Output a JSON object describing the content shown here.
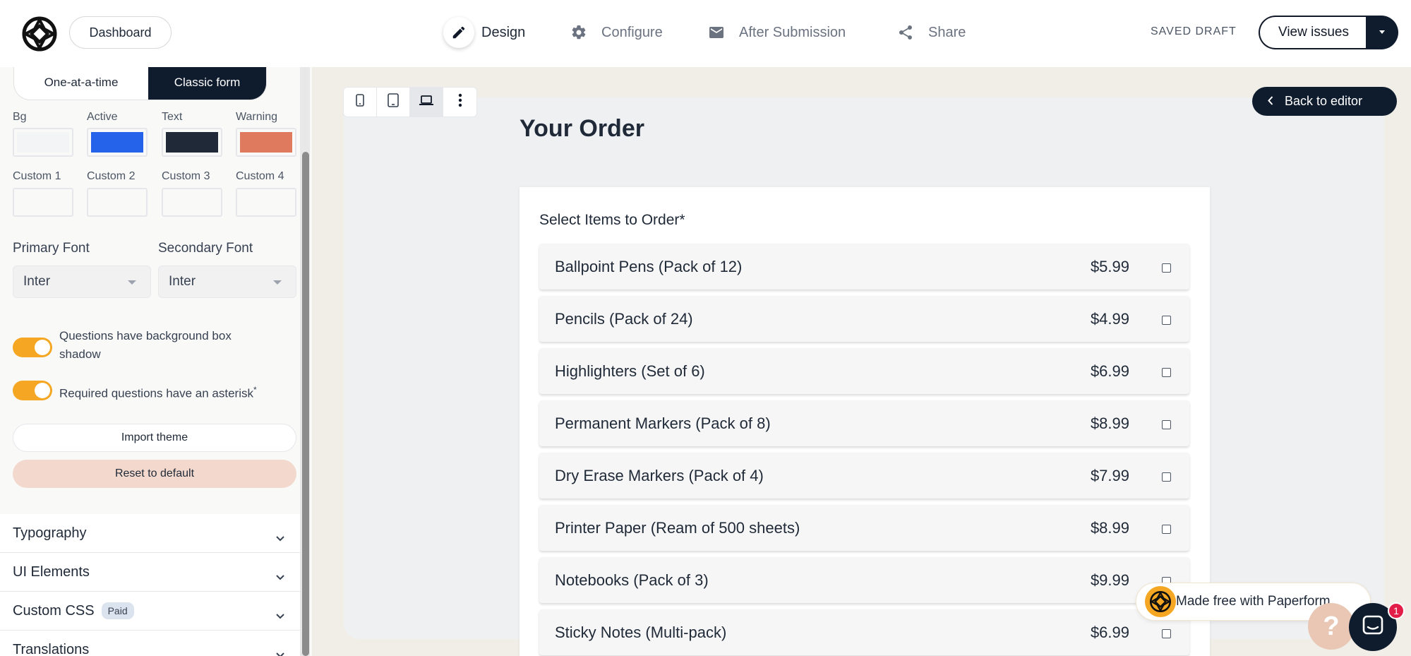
{
  "header": {
    "dashboard_label": "Dashboard",
    "nav": [
      {
        "label": "Design",
        "icon": "pencil-icon"
      },
      {
        "label": "Configure",
        "icon": "gear-icon"
      },
      {
        "label": "After Submission",
        "icon": "envelope-icon"
      },
      {
        "label": "Share",
        "icon": "share-icon"
      }
    ],
    "saved_status": "SAVED DRAFT",
    "view_issues_label": "View issues"
  },
  "sidebar": {
    "layout_options": [
      "One-at-a-time",
      "Classic form"
    ],
    "selected_layout": "Classic form",
    "colors": [
      {
        "label": "Bg",
        "value": "#f3f4f6"
      },
      {
        "label": "Active",
        "value": "#2563eb"
      },
      {
        "label": "Text",
        "value": "#1f2937"
      },
      {
        "label": "Warning",
        "value": "#e07a5f"
      },
      {
        "label": "Custom 1",
        "value": "#ffffff"
      },
      {
        "label": "Custom 2",
        "value": "#ffffff"
      },
      {
        "label": "Custom 3",
        "value": "#ffffff"
      },
      {
        "label": "Custom 4",
        "value": "#ffffff"
      }
    ],
    "primary_font_label": "Primary Font",
    "primary_font_value": "Inter",
    "secondary_font_label": "Secondary Font",
    "secondary_font_value": "Inter",
    "toggles": [
      {
        "label": "Questions have background box shadow",
        "on": true
      },
      {
        "label": "Required questions have an asterisk",
        "on": true
      }
    ],
    "asterisk": "*",
    "import_theme_label": "Import theme",
    "reset_label": "Reset to default",
    "accordions": [
      {
        "label": "Typography"
      },
      {
        "label": "UI Elements"
      },
      {
        "label": "Custom CSS",
        "badge": "Paid"
      },
      {
        "label": "Translations"
      }
    ]
  },
  "preview": {
    "back_label": "Back to editor",
    "form_title": "Your Order",
    "question_label": "Select Items to Order*",
    "items": [
      {
        "name": "Ballpoint Pens (Pack of 12)",
        "price": "$5.99"
      },
      {
        "name": "Pencils (Pack of 24)",
        "price": "$4.99"
      },
      {
        "name": "Highlighters (Set of 6)",
        "price": "$6.99"
      },
      {
        "name": "Permanent Markers (Pack of 8)",
        "price": "$8.99"
      },
      {
        "name": "Dry Erase Markers (Pack of 4)",
        "price": "$7.99"
      },
      {
        "name": "Printer Paper (Ream of 500 sheets)",
        "price": "$8.99"
      },
      {
        "name": "Notebooks (Pack of 3)",
        "price": "$9.99"
      },
      {
        "name": "Sticky Notes (Multi-pack)",
        "price": "$6.99"
      }
    ],
    "made_free_label": "Made free with Paperform",
    "help_symbol": "?",
    "chat_badge_count": "1"
  },
  "colors": {
    "navy": "#0f1c2e",
    "accent_orange": "#f5a623"
  }
}
